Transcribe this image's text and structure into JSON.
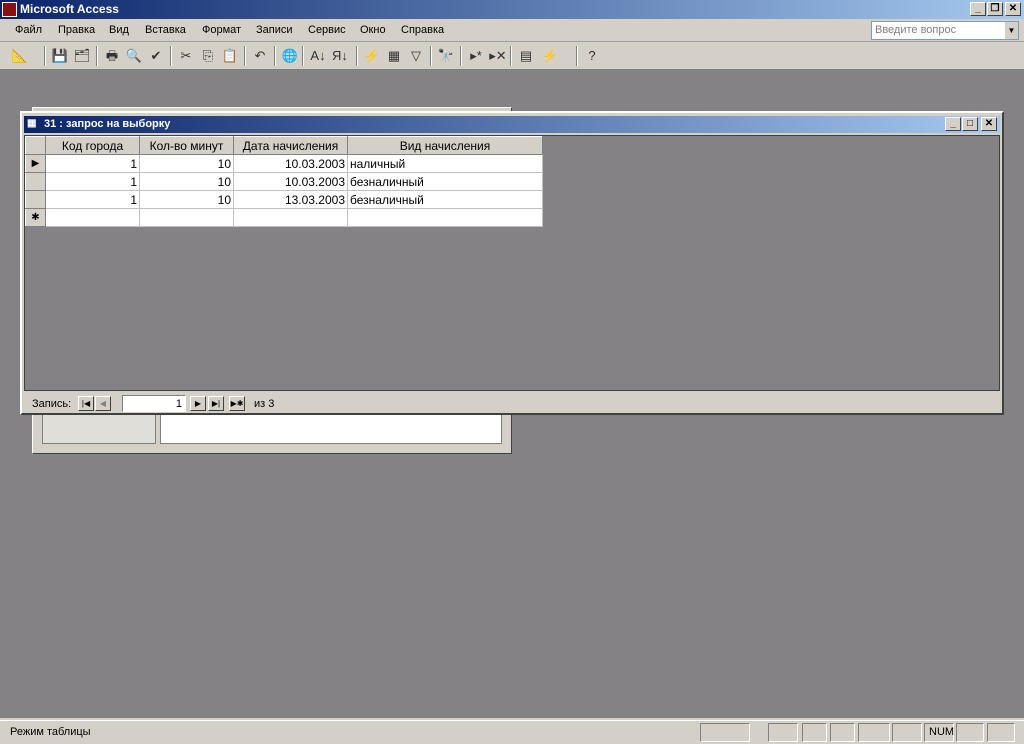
{
  "app": {
    "title": "Microsoft Access",
    "controls": {
      "minimize": "_",
      "restore": "❐",
      "close": "✕"
    }
  },
  "menu": [
    "Файл",
    "Правка",
    "Вид",
    "Вставка",
    "Формат",
    "Записи",
    "Сервис",
    "Окно",
    "Справка"
  ],
  "ask": {
    "placeholder": "Введите вопрос"
  },
  "toolbar": [
    {
      "icon": "design-view",
      "glyph": "📐"
    },
    {
      "icon": "save",
      "glyph": "💾"
    },
    {
      "icon": "file-search",
      "glyph": "🗂"
    },
    {
      "icon": "print",
      "glyph": "🖶"
    },
    {
      "icon": "print-preview",
      "glyph": "🔍"
    },
    {
      "icon": "spelling",
      "glyph": "✔"
    },
    {
      "icon": "cut",
      "glyph": "✂"
    },
    {
      "icon": "copy",
      "glyph": "⎘"
    },
    {
      "icon": "paste",
      "glyph": "📋"
    },
    {
      "icon": "undo",
      "glyph": "↶"
    },
    {
      "icon": "hyperlink",
      "glyph": "🌐"
    },
    {
      "icon": "sort-ascending",
      "glyph": "А↓"
    },
    {
      "icon": "sort-descending",
      "glyph": "Я↓"
    },
    {
      "icon": "filter-by-selection",
      "glyph": "⚡"
    },
    {
      "icon": "filter-by-form",
      "glyph": "▦"
    },
    {
      "icon": "apply-filter",
      "glyph": "▽"
    },
    {
      "icon": "find",
      "glyph": "🔭"
    },
    {
      "icon": "new-record",
      "glyph": "▸*"
    },
    {
      "icon": "delete-record",
      "glyph": "▸✕"
    },
    {
      "icon": "database-window",
      "glyph": "▤"
    },
    {
      "icon": "new-object",
      "glyph": "⚡"
    },
    {
      "icon": "help",
      "glyph": "?"
    }
  ],
  "query": {
    "title": "31 : запрос на выборку",
    "columns": [
      "Код города",
      "Кол-во минут",
      "Дата начисления",
      "Вид начисления"
    ],
    "rows": [
      [
        "1",
        "10",
        "10.03.2003",
        "наличный"
      ],
      [
        "1",
        "10",
        "10.03.2003",
        "безналичный"
      ],
      [
        "1",
        "10",
        "13.03.2003",
        "безналичный"
      ]
    ],
    "nav": {
      "label": "Запись:",
      "current": "1",
      "of": "из  3"
    },
    "win_controls": {
      "minimize": "_",
      "maximize": "□",
      "close": "✕"
    }
  },
  "status": {
    "mode": "Режим таблицы",
    "num": "NUM"
  }
}
